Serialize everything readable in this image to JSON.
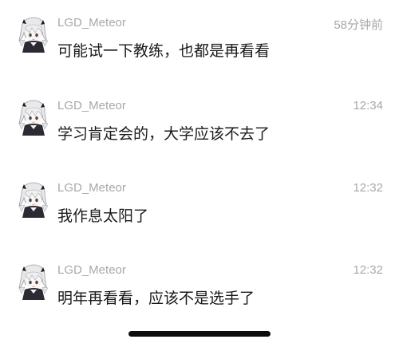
{
  "messages": [
    {
      "username": "LGD_Meteor",
      "time": "58分钟前",
      "text": "可能试一下教练，也都是再看看",
      "avatar_icon": "anime-avatar-icon"
    },
    {
      "username": "LGD_Meteor",
      "time": "12:34",
      "text": "学习肯定会的，大学应该不去了",
      "avatar_icon": "anime-avatar-icon"
    },
    {
      "username": "LGD_Meteor",
      "time": "12:32",
      "text": "我作息太阳了",
      "avatar_icon": "anime-avatar-icon"
    },
    {
      "username": "LGD_Meteor",
      "time": "12:32",
      "text": "明年再看看，应该不是选手了",
      "avatar_icon": "anime-avatar-icon"
    }
  ],
  "colors": {
    "meta_text": "#a8a8a8",
    "body_text": "#1a1a1a",
    "home_indicator": "#0d0d0d"
  }
}
